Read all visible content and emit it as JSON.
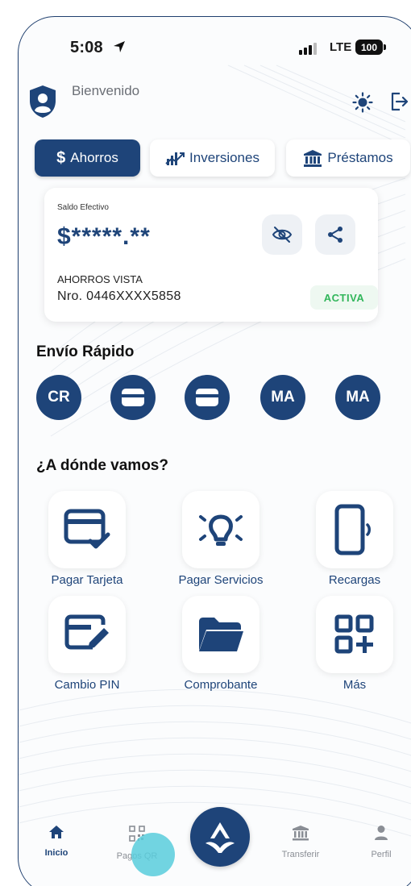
{
  "status_bar": {
    "time": "5:08",
    "network": "LTE",
    "battery": "100"
  },
  "header": {
    "welcome": "Bienvenido"
  },
  "tabs": [
    {
      "label": "Ahorros",
      "icon": "dollar-icon",
      "active": true
    },
    {
      "label": "Inversiones",
      "icon": "chart-icon",
      "active": false
    },
    {
      "label": "Préstamos",
      "icon": "bank-icon",
      "active": false
    }
  ],
  "account_card": {
    "caption": "Saldo Efectivo",
    "amount": "$*****.**",
    "account_type": "AHORROS VISTA",
    "account_number": "Nro. 0446XXXX5858",
    "status": "ACTIVA"
  },
  "quick_send": {
    "title": "Envío Rápido",
    "contacts": [
      {
        "initials": "CR",
        "icon": ""
      },
      {
        "initials": "",
        "icon": "card-icon"
      },
      {
        "initials": "",
        "icon": "card-icon"
      },
      {
        "initials": "MA",
        "icon": ""
      },
      {
        "initials": "MA",
        "icon": ""
      }
    ]
  },
  "destinations": {
    "title": "¿A dónde vamos?",
    "items": [
      {
        "label": "Pagar Tarjeta",
        "icon": "credit-card-check-icon"
      },
      {
        "label": "Pagar Servicios",
        "icon": "lightbulb-icon"
      },
      {
        "label": "Recargas",
        "icon": "phone-signal-icon"
      },
      {
        "label": "Cambio PIN",
        "icon": "card-edit-icon"
      },
      {
        "label": "Comprobante",
        "icon": "folder-icon"
      },
      {
        "label": "Más",
        "icon": "grid-plus-icon"
      }
    ]
  },
  "bottom_nav": [
    {
      "label": "Inicio",
      "icon": "home-icon",
      "active": true
    },
    {
      "label": "Pagos QR",
      "icon": "qr-icon",
      "active": false
    },
    {
      "label": "Transferir",
      "icon": "bank-icon",
      "active": false
    },
    {
      "label": "Perfil",
      "icon": "person-icon",
      "active": false
    }
  ],
  "colors": {
    "primary": "#1e4479",
    "success": "#32b65b",
    "muted": "#8a8e95"
  }
}
